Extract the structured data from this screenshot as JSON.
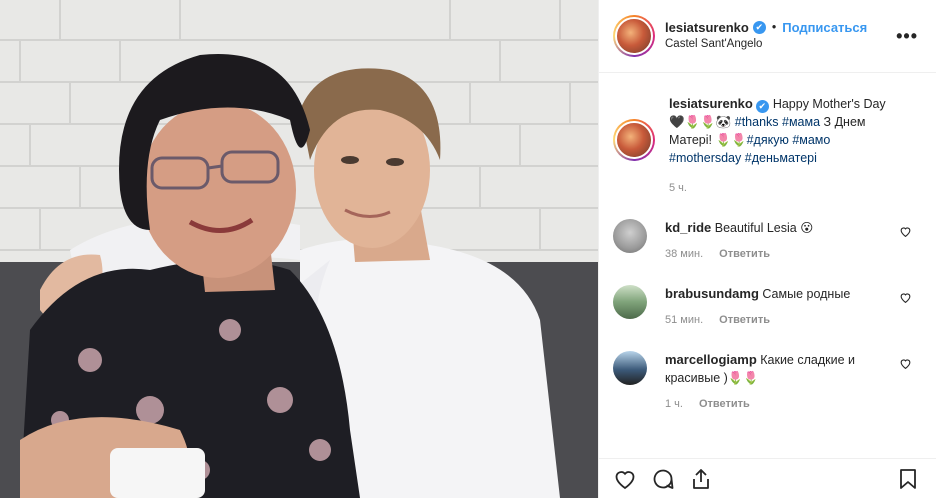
{
  "header": {
    "username": "lesiatsurenko",
    "verified_mark": "✔",
    "separator": "•",
    "follow_label": "Подписаться",
    "location": "Castel Sant'Angelo",
    "more_label": "•••"
  },
  "caption": {
    "username": "lesiatsurenko",
    "text_1": "Happy Mother's Day 🖤🌷🌷🐼",
    "tag_thanks": "#thanks",
    "tag_mama": "#мама",
    "text_2": "З Днем Матері! 🌷🌷",
    "tag_dyakuyu": "#дякую",
    "tag_mamo": "#мамо",
    "tag_mothersday": "#mothersday",
    "tag_denmateri": "#деньматері",
    "time": "5 ч."
  },
  "comments": [
    {
      "username": "kd_ride",
      "text": "Beautiful Lesia 😮",
      "time": "38 мин.",
      "reply": "Ответить"
    },
    {
      "username": "brabusundamg",
      "text": "Самые родные",
      "time": "51 мин.",
      "reply": "Ответить"
    },
    {
      "username": "marcellogiamp",
      "text": "Какие сладкие и красивые )🌷🌷",
      "time": "1 ч.",
      "reply": "Ответить"
    }
  ],
  "icons": {
    "like": "heart-icon",
    "comment": "comment-icon",
    "share": "share-icon",
    "save": "bookmark-icon",
    "more": "more-options-icon",
    "verified": "verified-badge-icon"
  },
  "colors": {
    "link_blue": "#3897f0",
    "hashtag": "#003569",
    "muted": "#8e8e8e",
    "border": "#efefef"
  }
}
